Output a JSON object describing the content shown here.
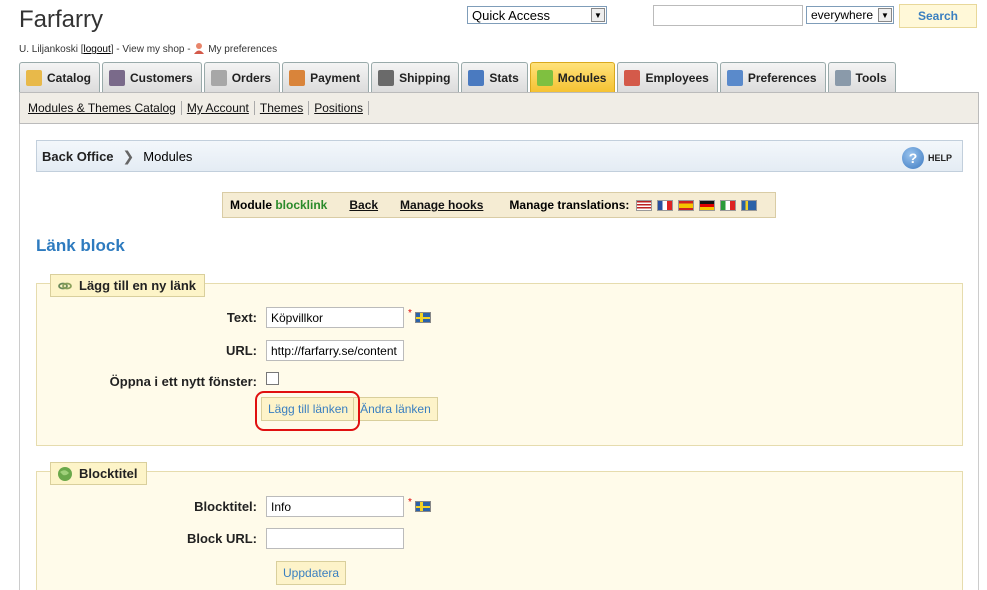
{
  "shop": {
    "title": "Farfarry"
  },
  "userline": {
    "user": "U. Liljankoski",
    "bracket_open": "[",
    "logout": "logout",
    "bracket_close": "]",
    "dash1": "-",
    "view_shop": "View my shop",
    "dash2": "-",
    "preferences": "My preferences"
  },
  "header": {
    "quick_access": "Quick Access",
    "search_value": "",
    "search_scope": "everywhere",
    "search_button": "Search"
  },
  "tabs": [
    {
      "label": "Catalog",
      "icon": "folder-icon",
      "color": "#e8b94a",
      "active": false
    },
    {
      "label": "Customers",
      "icon": "person-icon",
      "color": "#7a6a8a",
      "active": false
    },
    {
      "label": "Orders",
      "icon": "cart-icon",
      "color": "#a7a7a7",
      "active": false
    },
    {
      "label": "Payment",
      "icon": "payment-icon",
      "color": "#d9843a",
      "active": false
    },
    {
      "label": "Shipping",
      "icon": "truck-icon",
      "color": "#6a6a6a",
      "active": false
    },
    {
      "label": "Stats",
      "icon": "chart-icon",
      "color": "#4a7ac0",
      "active": false
    },
    {
      "label": "Modules",
      "icon": "puzzle-icon",
      "color": "#7fc040",
      "active": true
    },
    {
      "label": "Employees",
      "icon": "employee-icon",
      "color": "#d45a4a",
      "active": false
    },
    {
      "label": "Preferences",
      "icon": "preferences-icon",
      "color": "#5a8acb",
      "active": false
    },
    {
      "label": "Tools",
      "icon": "wrench-icon",
      "color": "#8a9aaa",
      "active": false
    }
  ],
  "subnav": [
    "Modules & Themes Catalog",
    "My Account",
    "Themes",
    "Positions"
  ],
  "breadcrumb": {
    "root": "Back Office",
    "separator": "❯",
    "current": "Modules",
    "help": "HELP",
    "help_icon": "?"
  },
  "module_bar": {
    "module_prefix": "Module",
    "module_name": "blocklink",
    "back": "Back",
    "manage_hooks": "Manage hooks",
    "manage_translations": "Manage translations:",
    "flags": [
      "us-flag-icon",
      "fr-flag-icon",
      "es-flag-icon",
      "de-flag-icon",
      "it-flag-icon",
      "se-flag-icon"
    ]
  },
  "page": {
    "heading": "Länk block"
  },
  "add_link": {
    "legend": "Lägg till en ny länk",
    "text_label": "Text:",
    "text_value": "Köpvillkor",
    "url_label": "URL:",
    "url_value": "http://farfarry.se/content",
    "new_window_label": "Öppna i ett nytt fönster:",
    "new_window_checked": false,
    "add_button": "Lägg till länken",
    "edit_button": "Ändra länken",
    "required_mark": "*"
  },
  "block_title": {
    "legend": "Blocktitel",
    "title_label": "Blocktitel:",
    "title_value": "Info",
    "url_label": "Block URL:",
    "url_value": "",
    "update_button": "Uppdatera",
    "required_mark": "*"
  }
}
